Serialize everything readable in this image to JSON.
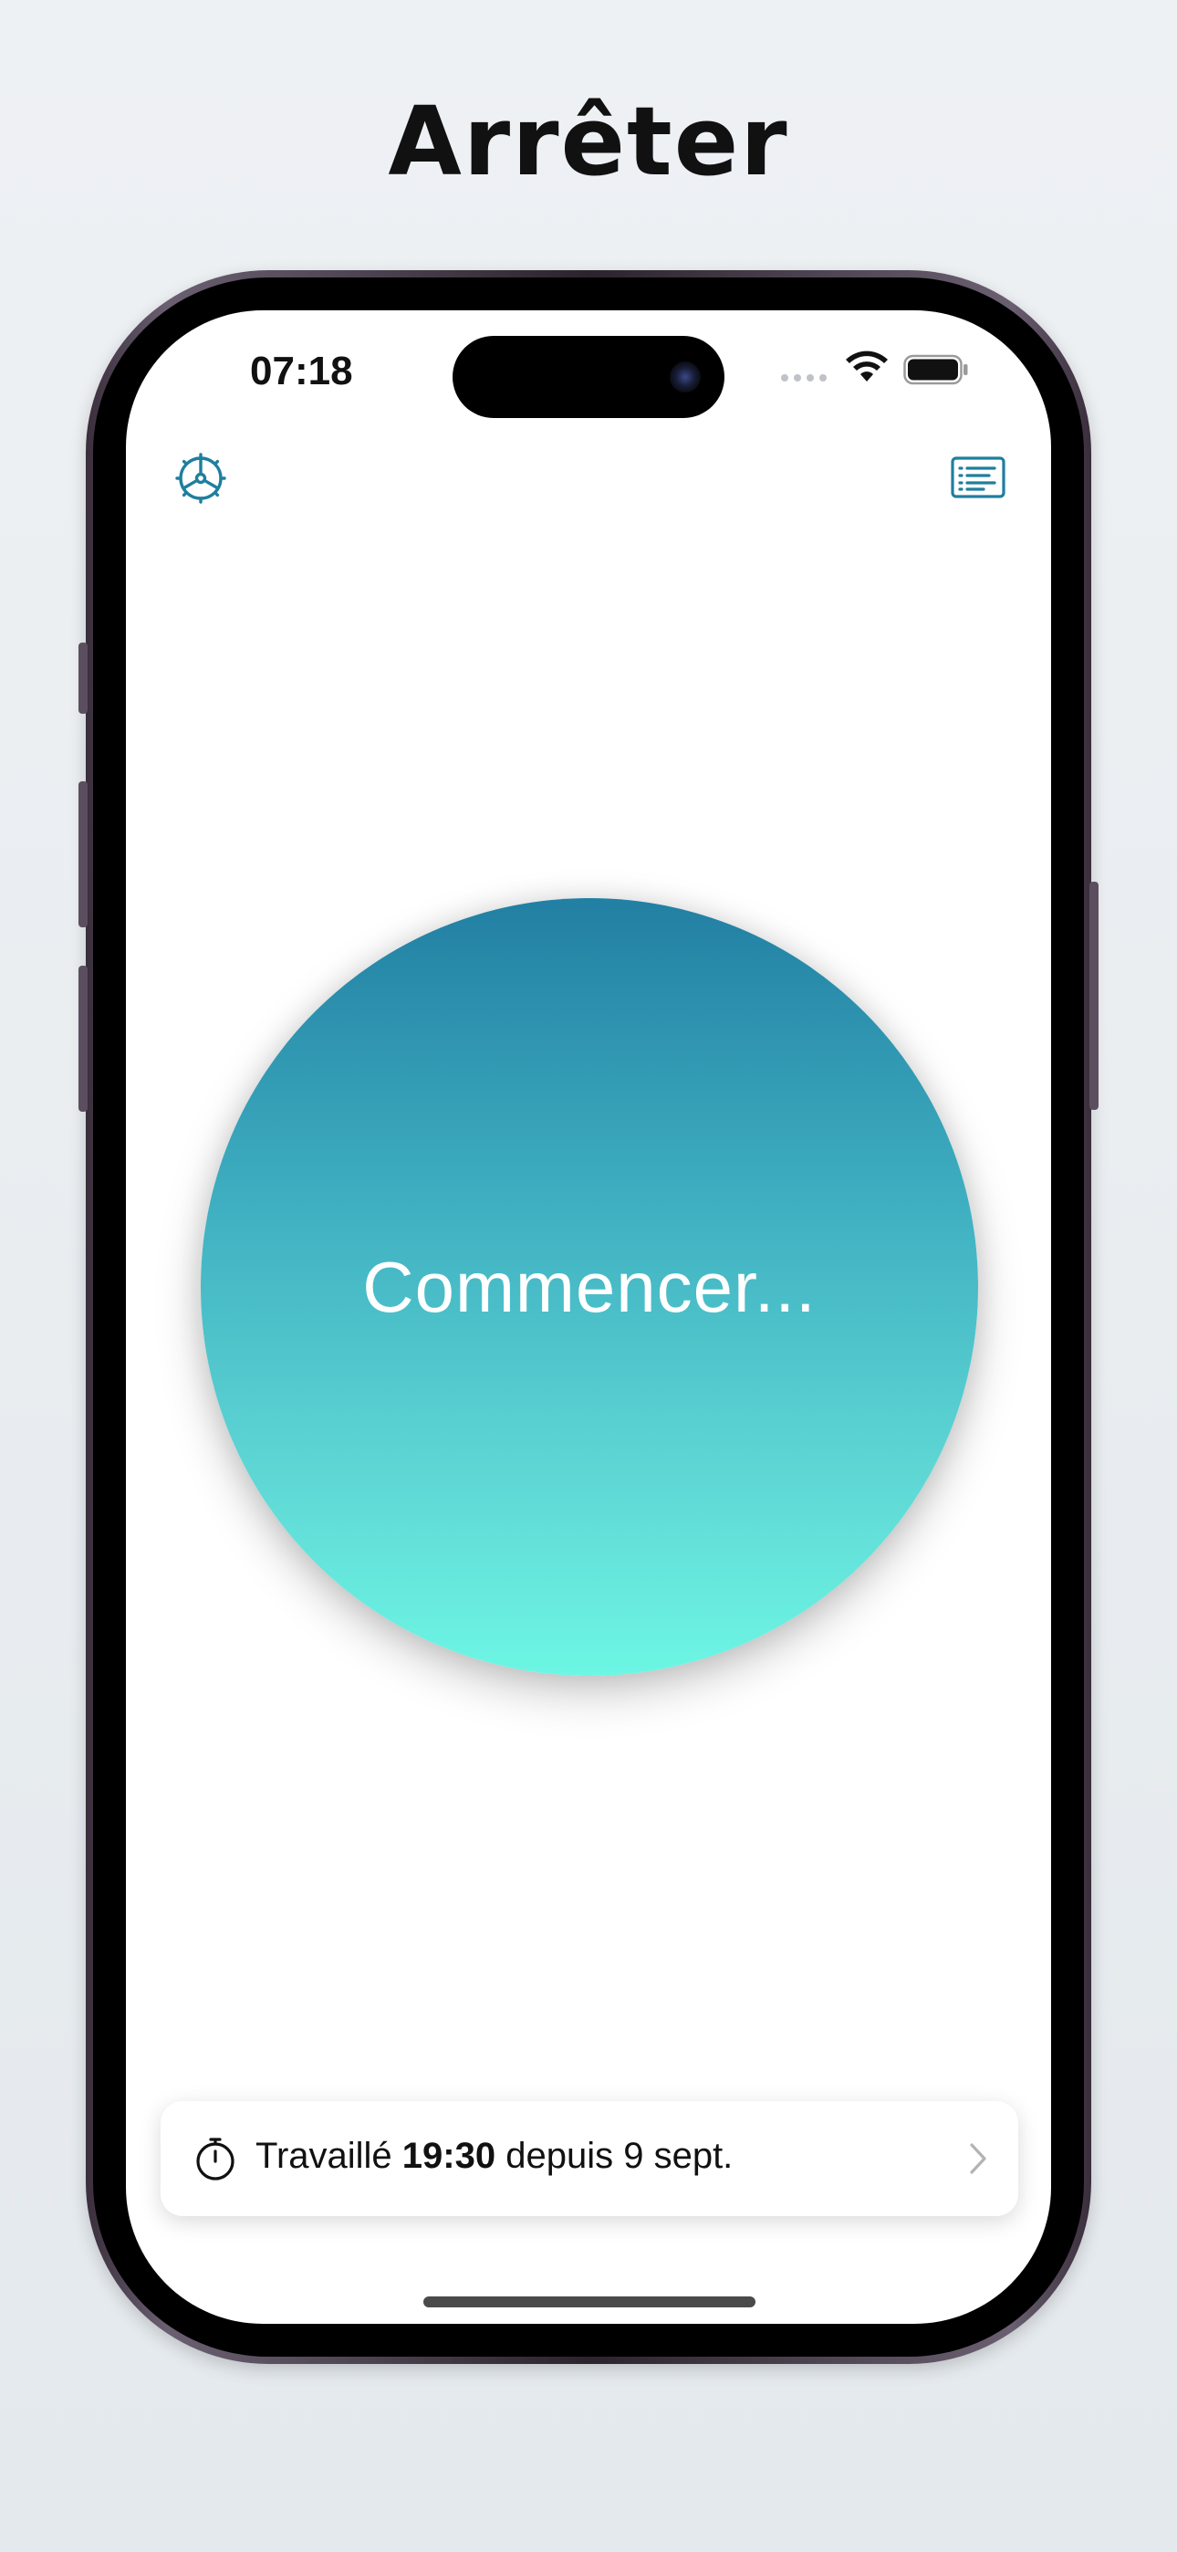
{
  "headline": "Arrêter",
  "status_bar": {
    "time": "07:18"
  },
  "toolbar": {
    "settings_icon": "gear-helm-icon",
    "list_icon": "list-icon",
    "accent_color": "#1f7f9e"
  },
  "main": {
    "start_label": "Commencer...",
    "gradient_top": "#227fa3",
    "gradient_bottom": "#6df6e4"
  },
  "summary": {
    "prefix": "Travaillé",
    "duration": "19:30",
    "suffix": "depuis 9 sept.",
    "timer_icon": "stopwatch-icon",
    "chevron_icon": "chevron-right-icon"
  }
}
